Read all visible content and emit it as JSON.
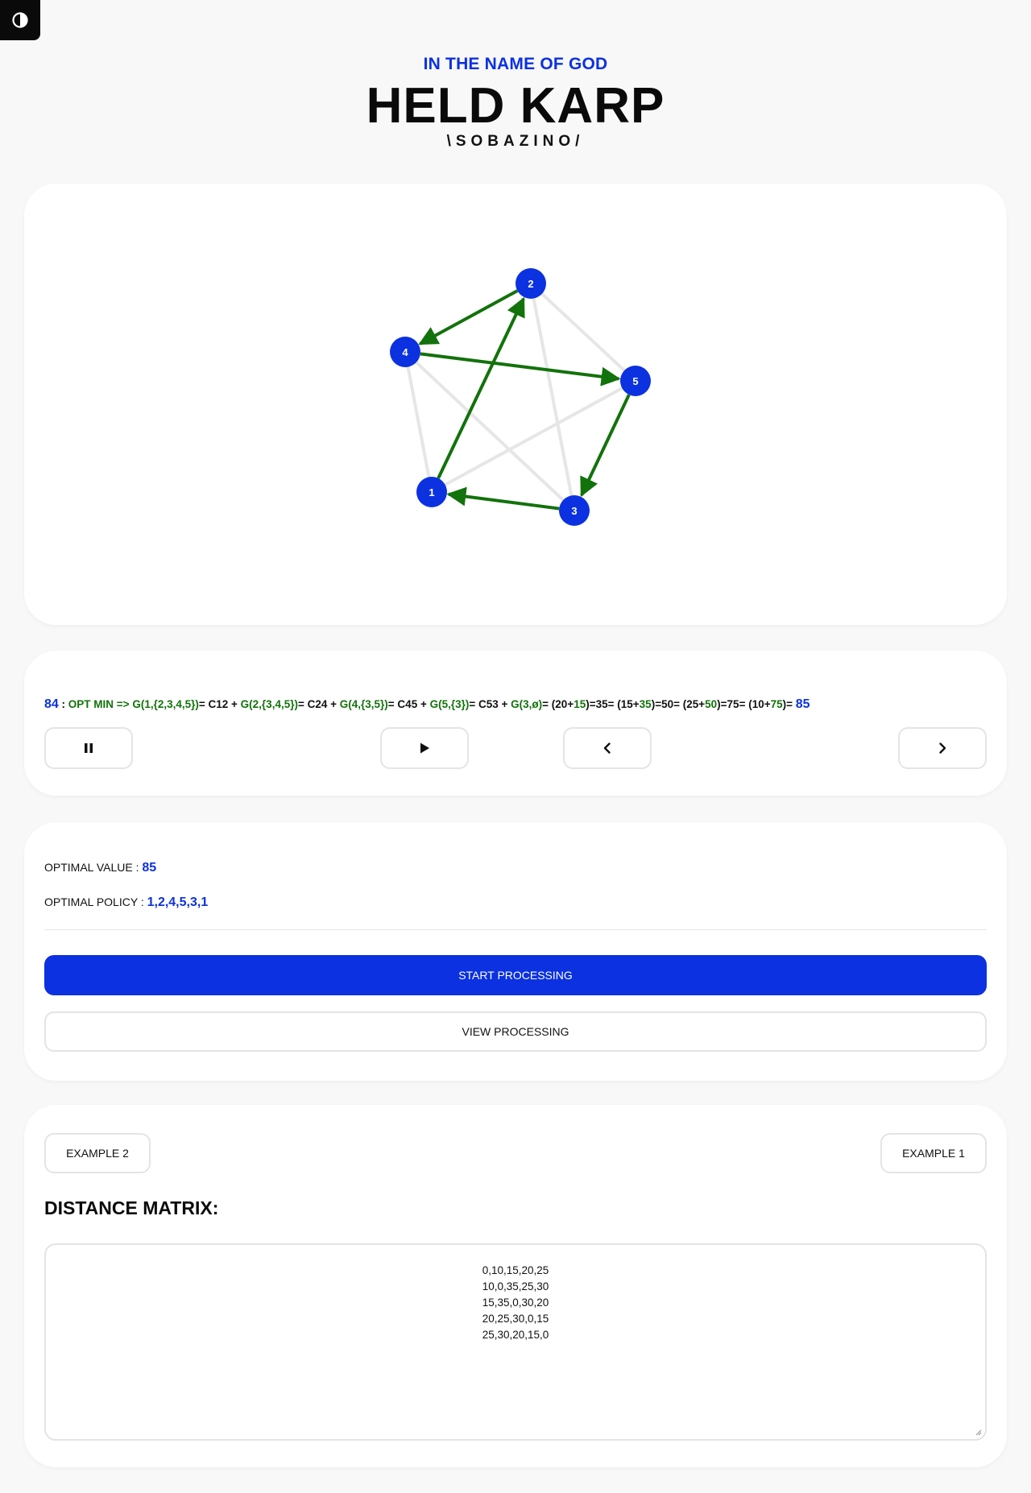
{
  "header": {
    "kicker": "IN THE NAME OF GOD",
    "title": "HELD KARP",
    "subtitle": "\\SOBAZINO/"
  },
  "colors": {
    "accent": "#0b31e0",
    "path": "#12720b",
    "edge": "#e6e6e6",
    "node": "#0b31e0"
  },
  "graph": {
    "nodes": [
      {
        "id": "1",
        "label": "1"
      },
      {
        "id": "2",
        "label": "2"
      },
      {
        "id": "3",
        "label": "3"
      },
      {
        "id": "4",
        "label": "4"
      },
      {
        "id": "5",
        "label": "5"
      }
    ],
    "highlighted_tour": [
      "1",
      "2",
      "4",
      "5",
      "3",
      "1"
    ]
  },
  "steps": {
    "index": "84",
    "sep": " : ",
    "opt": "OPT MIN => ",
    "g1": "G(1,{2,3,4,5})",
    "eq1": "= C12 + ",
    "g2": "G(2,{3,4,5})",
    "eq2": "= C24 + ",
    "g3": "G(4,{3,5})",
    "eq3": "= C45 + ",
    "g4": "G(5,{3})",
    "eq4": "= C53 + ",
    "g5": "G(3,ø)",
    "eq5": "= (20+",
    "n15": "15",
    "eq6": ")=35= (15+",
    "n35": "35",
    "eq7": ")=50= (25+",
    "n50": "50",
    "eq8": ")=75= (10+",
    "n75": "75",
    "eq9": ")= ",
    "result": "85"
  },
  "controls": {
    "pause_icon": "pause-icon",
    "play_icon": "play-icon",
    "prev_icon": "chevron-left-icon",
    "next_icon": "chevron-right-icon"
  },
  "result": {
    "value_label": "OPTIMAL VALUE : ",
    "value": "85",
    "policy_label": "OPTIMAL POLICY : ",
    "policy": "1,2,4,5,3,1",
    "start_label": "START PROCESSING",
    "view_label": "VIEW PROCESSING"
  },
  "matrix": {
    "example2_label": "EXAMPLE 2",
    "example1_label": "EXAMPLE 1",
    "heading": "DISTANCE MATRIX:",
    "rows": [
      "0,10,15,20,25",
      "10,0,35,25,30",
      "15,35,0,30,20",
      "20,25,30,0,15",
      "25,30,20,15,0"
    ]
  }
}
